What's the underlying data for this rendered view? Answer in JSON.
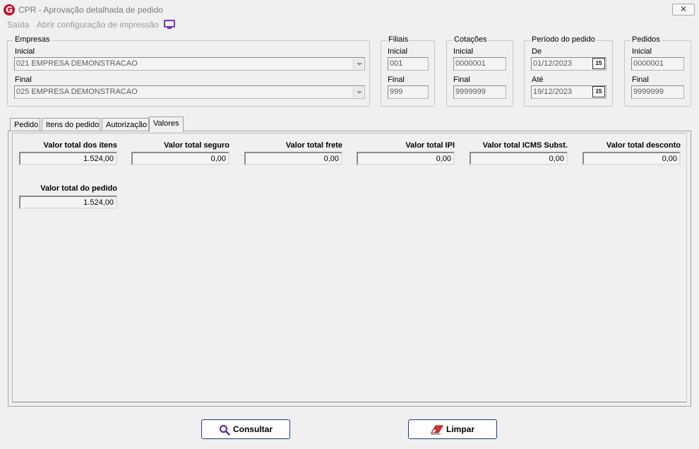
{
  "window": {
    "title": "CPR - Aprovação detalhada de pedido",
    "logo_letter": "G",
    "close_label": "✕"
  },
  "menu": {
    "items": [
      {
        "label": "Saída"
      },
      {
        "label": "Abrir configuração de impressão"
      }
    ],
    "monitor_icon": "monitor-icon"
  },
  "filters": {
    "empresas": {
      "title": "Empresas",
      "initial_label": "Inicial",
      "initial_value": "021 EMPRESA DEMONSTRACAO",
      "final_label": "Final",
      "final_value": "025 EMPRESA DEMONSTRACAO"
    },
    "filiais": {
      "title": "Filiais",
      "initial_label": "Inicial",
      "initial_value": "001",
      "final_label": "Final",
      "final_value": "999"
    },
    "cotacoes": {
      "title": "Cotações",
      "initial_label": "Inicial",
      "initial_value": "0000001",
      "final_label": "Final",
      "final_value": "9999999"
    },
    "periodo": {
      "title": "Período do pedido",
      "from_label": "De",
      "from_value": "01/12/2023",
      "to_label": "Até",
      "to_value": "19/12/2023",
      "calendar_label": "15"
    },
    "pedidos": {
      "title": "Pedidos",
      "initial_label": "Inicial",
      "initial_value": "0000001",
      "final_label": "Final",
      "final_value": "9999999"
    }
  },
  "tabs": [
    {
      "label": "Pedido",
      "active": false
    },
    {
      "label": "Itens do pedido",
      "active": false
    },
    {
      "label": "Autorização",
      "active": false
    },
    {
      "label": "Valores",
      "active": true
    }
  ],
  "valores": {
    "total_itens": {
      "label": "Valor total dos itens",
      "value": "1.524,00"
    },
    "total_seguro": {
      "label": "Valor total seguro",
      "value": "0,00"
    },
    "total_frete": {
      "label": "Valor total frete",
      "value": "0,00"
    },
    "total_ipi": {
      "label": "Valor total IPI",
      "value": "0,00"
    },
    "total_icms_subst": {
      "label": "Valor total ICMS Subst.",
      "value": "0,00"
    },
    "total_desconto": {
      "label": "Valor total desconto",
      "value": "0,00"
    },
    "total_pedido": {
      "label": "Valor total do pedido",
      "value": "1.524,00"
    }
  },
  "buttons": {
    "consultar": {
      "label": "Consultar",
      "icon": "search-icon"
    },
    "limpar": {
      "label": "Limpar",
      "icon": "eraser-icon"
    }
  },
  "colors": {
    "accent": "#1e3d74",
    "logo": "#c8102e",
    "monitor": "#7b2fbf"
  }
}
